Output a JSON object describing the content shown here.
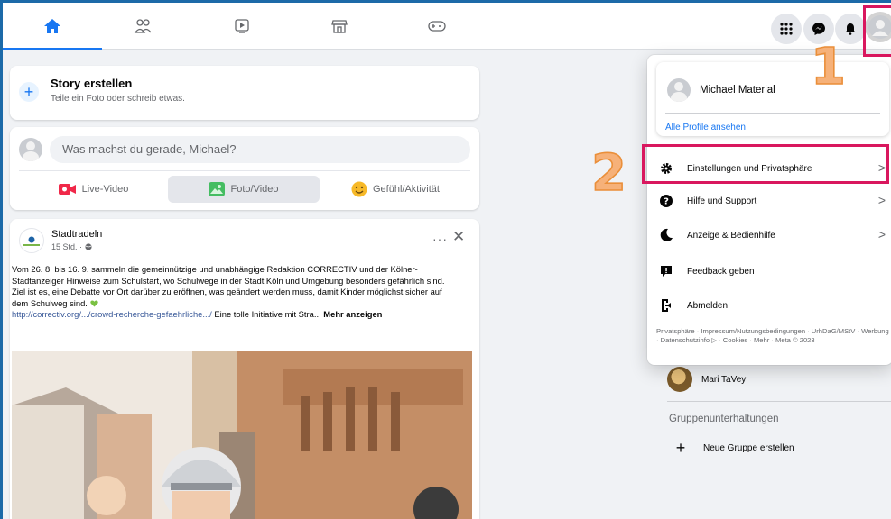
{
  "nav": {
    "tabs": [
      {
        "name": "home",
        "icon": "home-icon"
      },
      {
        "name": "friends",
        "icon": "friends-icon"
      },
      {
        "name": "watch",
        "icon": "video-icon"
      },
      {
        "name": "marketplace",
        "icon": "marketplace-icon"
      },
      {
        "name": "gaming",
        "icon": "gaming-icon"
      }
    ],
    "right_buttons": [
      "menu-grid-icon",
      "messenger-icon",
      "notifications-bell-icon",
      "profile-avatar"
    ],
    "accent": "#1877f2"
  },
  "story": {
    "title": "Story erstellen",
    "subtitle": "Teile ein Foto oder schreib etwas."
  },
  "composer": {
    "placeholder": "Was machst du gerade, Michael?",
    "live": "Live-Video",
    "photo": "Foto/Video",
    "feeling": "Gefühl/Aktivität"
  },
  "post": {
    "author": "Stadtradeln",
    "time": "15 Std. · ",
    "text1": "Vom 26. 8. bis 16. 9. sammeln die gemeinnützige und unabhängige Redaktion CORRECTIV und der Kölner-Stadtanzeiger Hinweise zum Schulstart, wo Schulwege in der Stadt Köln und Umgebung besonders gefährlich sind. Ziel ist es, eine Debatte vor Ort darüber zu eröffnen, was geändert werden muss, damit Kinder möglichst sicher auf dem Schulweg sind. ",
    "link": "http://correctiv.org/.../crowd-recherche-gefaehrliche.../",
    "text2": " Eine tolle Initiative mit Stra...",
    "more": "Mehr anzeigen"
  },
  "menu": {
    "profile_name": "Michael Material",
    "all_profiles": "Alle Profile ansehen",
    "items": [
      {
        "label": "Einstellungen und Privatsphäre",
        "icon": "gear-icon",
        "chevron": true
      },
      {
        "label": "Hilfe und Support",
        "icon": "help-icon",
        "chevron": true
      },
      {
        "label": "Anzeige & Bedienhilfe",
        "icon": "moon-icon",
        "chevron": true
      },
      {
        "label": "Feedback geben",
        "icon": "feedback-icon",
        "chevron": false
      },
      {
        "label": "Abmelden",
        "icon": "logout-icon",
        "chevron": false
      }
    ],
    "footer": "Privatsphäre · Impressum/Nutzungsbedingungen · UrhDaG/MStV · Werbung · Datenschutzinfo ▷ · Cookies · Mehr · Meta © 2023"
  },
  "right": {
    "contact": "Mari TaVey",
    "groups_title": "Gruppenunterhaltungen",
    "new_group": "Neue Gruppe erstellen"
  },
  "annotations": {
    "step1": "1",
    "step2": "2",
    "highlight_color": "#d9175e",
    "number_color": "#f6b179"
  }
}
